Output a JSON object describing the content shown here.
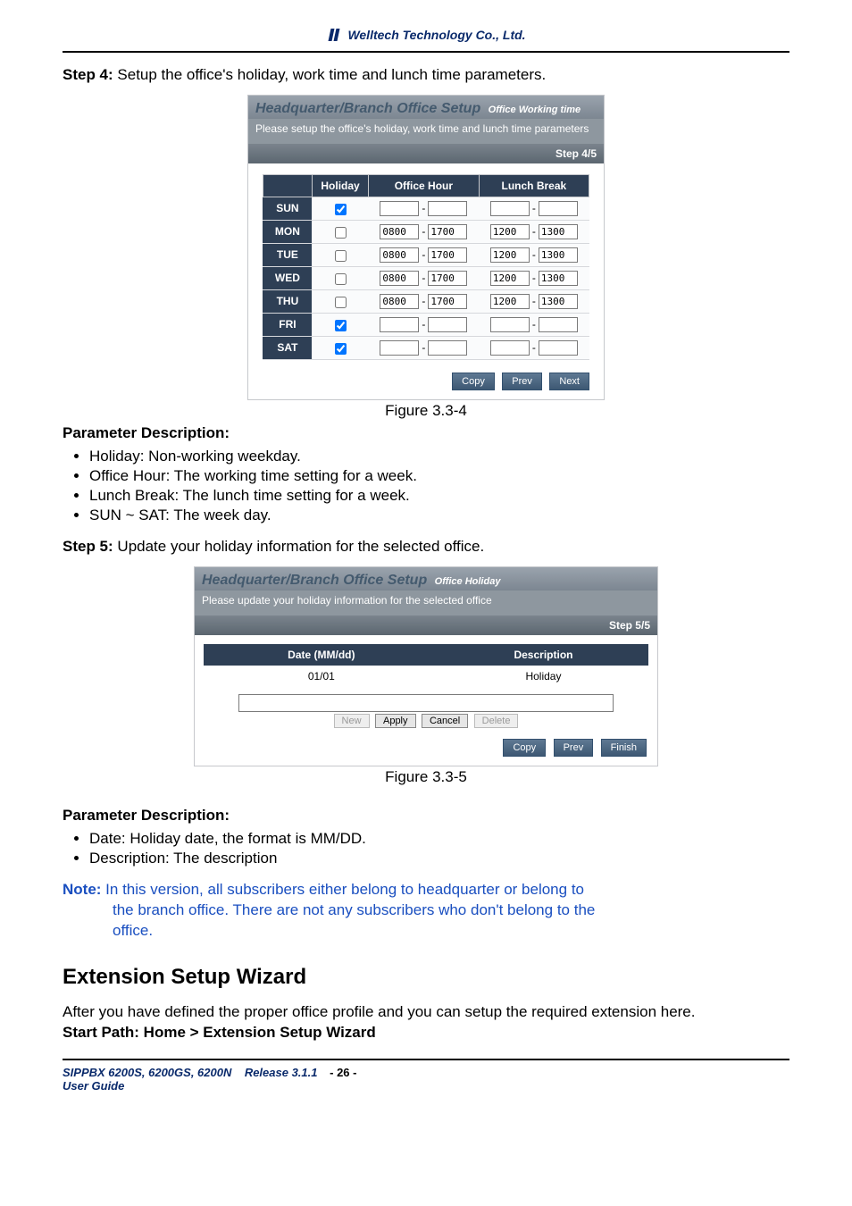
{
  "header": {
    "company": "Welltech Technology Co., Ltd."
  },
  "step4": {
    "heading_prefix": "Step 4:",
    "heading_rest": " Setup the office's holiday, work time and lunch time parameters."
  },
  "fig4": {
    "title_main": "Headquarter/Branch Office Setup",
    "title_sub": "Office Working time",
    "desc": "Please setup the office's holiday, work time and lunch time parameters",
    "step": "Step 4/5",
    "cols": {
      "holiday": "Holiday",
      "office_hour": "Office Hour",
      "lunch_break": "Lunch Break"
    },
    "rows": [
      {
        "day": "SUN",
        "holiday": true,
        "oh1": "",
        "oh2": "",
        "lb1": "",
        "lb2": ""
      },
      {
        "day": "MON",
        "holiday": false,
        "oh1": "0800",
        "oh2": "1700",
        "lb1": "1200",
        "lb2": "1300"
      },
      {
        "day": "TUE",
        "holiday": false,
        "oh1": "0800",
        "oh2": "1700",
        "lb1": "1200",
        "lb2": "1300"
      },
      {
        "day": "WED",
        "holiday": false,
        "oh1": "0800",
        "oh2": "1700",
        "lb1": "1200",
        "lb2": "1300"
      },
      {
        "day": "THU",
        "holiday": false,
        "oh1": "0800",
        "oh2": "1700",
        "lb1": "1200",
        "lb2": "1300"
      },
      {
        "day": "FRI",
        "holiday": true,
        "oh1": "",
        "oh2": "",
        "lb1": "",
        "lb2": ""
      },
      {
        "day": "SAT",
        "holiday": true,
        "oh1": "",
        "oh2": "",
        "lb1": "",
        "lb2": ""
      }
    ],
    "buttons": {
      "copy": "Copy",
      "prev": "Prev",
      "next": "Next"
    },
    "caption": "Figure 3.3-4"
  },
  "param_desc1": {
    "heading": "Parameter Description:",
    "bullets": [
      "Holiday: Non-working weekday.",
      "Office Hour: The working time setting for a week.",
      "Lunch Break: The lunch time setting for a week.",
      "SUN ~ SAT: The week day."
    ]
  },
  "step5": {
    "heading_prefix": "Step 5:",
    "heading_rest": " Update your holiday information for the selected office."
  },
  "fig5": {
    "title_main": "Headquarter/Branch Office Setup",
    "title_sub": "Office Holiday",
    "desc": "Please update your holiday information for the selected office",
    "step": "Step 5/5",
    "cols": {
      "date": "Date (MM/dd)",
      "desc": "Description"
    },
    "row": {
      "date": "01/01",
      "desc": "Holiday"
    },
    "edit_value": "",
    "buttons": {
      "new": "New",
      "apply": "Apply",
      "cancel": "Cancel",
      "delete": "Delete",
      "copy": "Copy",
      "prev": "Prev",
      "finish": "Finish"
    },
    "caption": "Figure 3.3-5"
  },
  "param_desc2": {
    "heading": "Parameter Description:",
    "bullets": [
      "Date: Holiday date, the format is MM/DD.",
      "Description: The description"
    ]
  },
  "note": {
    "label": "Note:",
    "line1": " In this version, all subscribers either belong to headquarter or belong to",
    "line2": "the branch office. There are not any subscribers who don't belong to the",
    "line3": "office."
  },
  "ext_wizard": {
    "heading": "Extension Setup Wizard",
    "para": "After you have defined the proper office profile and you can setup the required extension here.",
    "path": "Start Path: Home > Extension Setup Wizard"
  },
  "footer": {
    "product": "SIPPBX 6200S, 6200GS, 6200N",
    "release": "Release 3.1.1",
    "guide": "User Guide",
    "page": "- 26 -"
  }
}
